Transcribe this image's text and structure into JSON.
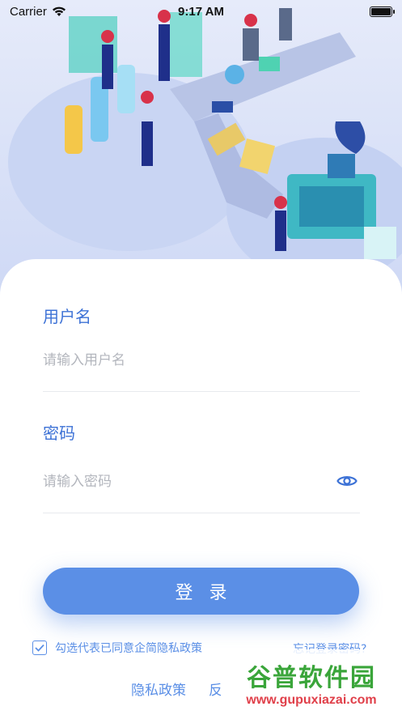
{
  "status_bar": {
    "carrier": "Carrier",
    "time": "9:17 AM"
  },
  "login_form": {
    "username_label": "用户名",
    "username_placeholder": "请输入用户名",
    "password_label": "密码",
    "password_placeholder": "请输入密码",
    "login_button": "登录",
    "agree_text": "勾选代表已同意企简隐私政策",
    "agree_checked": true,
    "forgot_password": "忘记登录密码?"
  },
  "footer": {
    "privacy_policy": "隐私政策",
    "second_link_partial": "反"
  },
  "watermark": {
    "main": "谷普软件园",
    "sub": "www.gupuxiazai.com"
  },
  "colors": {
    "accent": "#5b8fe6",
    "label": "#3d72d6",
    "placeholder": "#b3b6bd",
    "hero_bg": "#dfe6f8"
  },
  "icons": {
    "wifi": "wifi-icon",
    "battery": "battery-icon",
    "eye": "eye-icon",
    "check": "check-icon"
  }
}
